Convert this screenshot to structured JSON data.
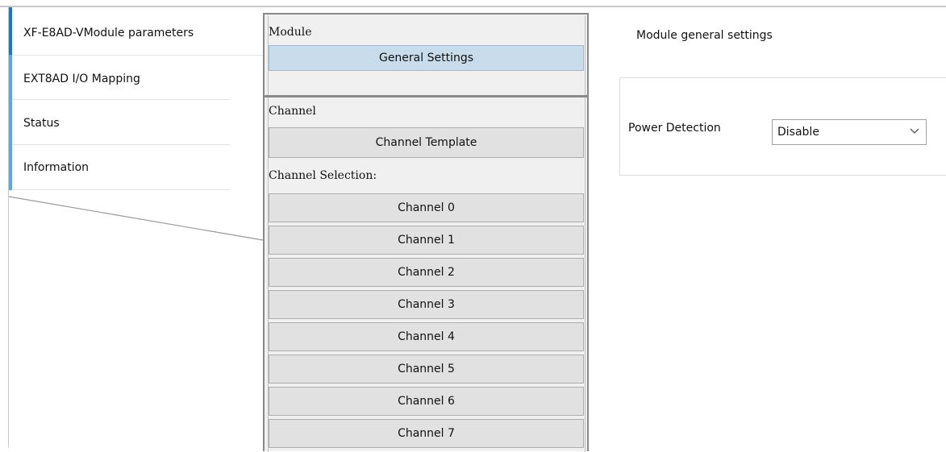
{
  "nav": {
    "items": [
      {
        "label": "XF-E8AD-VModule parameters",
        "active": true
      },
      {
        "label": "EXT8AD I/O Mapping",
        "active": false
      },
      {
        "label": "Status",
        "active": false
      },
      {
        "label": "Information",
        "active": false
      }
    ]
  },
  "module": {
    "section_label": "Module",
    "general_settings_label": "General Settings"
  },
  "channel": {
    "section_label": "Channel",
    "template_label": "Channel Template",
    "selection_label": "Channel Selection:",
    "channels": [
      "Channel 0",
      "Channel 1",
      "Channel 2",
      "Channel 3",
      "Channel 4",
      "Channel 5",
      "Channel 6",
      "Channel 7"
    ]
  },
  "settings": {
    "title": "Module general settings",
    "power_detection_label": "Power Detection",
    "power_detection_value": "Disable"
  },
  "colors": {
    "active_accent": "#1677d0",
    "tab_accent": "#56a8e6",
    "selected_button": "#c9dcec"
  }
}
